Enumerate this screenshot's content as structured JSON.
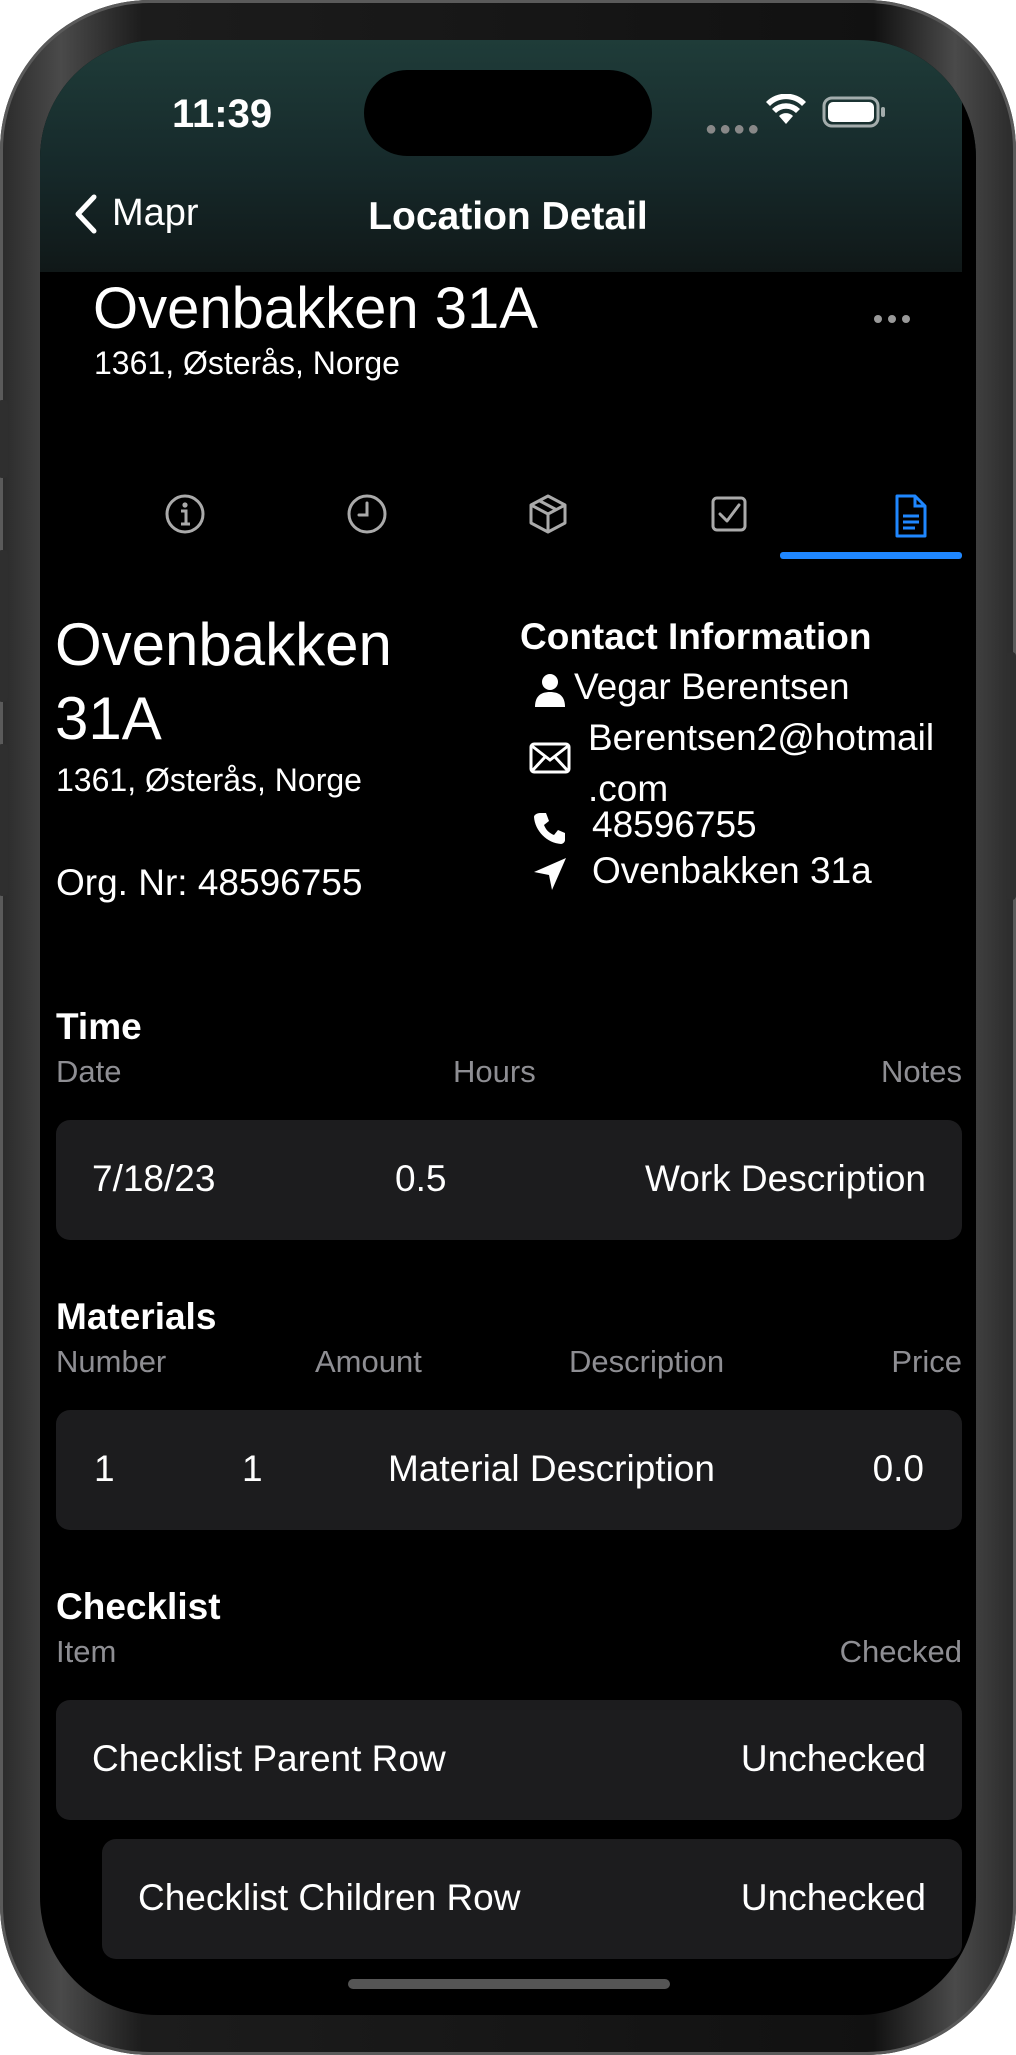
{
  "status_bar": {
    "time": "11:39"
  },
  "nav": {
    "back_label": "Mapr",
    "title": "Location Detail"
  },
  "header": {
    "title": "Ovenbakken 31A",
    "subtitle": "1361, Østerås, Norge"
  },
  "tabs": [
    {
      "name": "info",
      "icon": "info-circle-icon"
    },
    {
      "name": "time",
      "icon": "clock-icon"
    },
    {
      "name": "materials",
      "icon": "box-icon"
    },
    {
      "name": "checklist",
      "icon": "checkbox-icon"
    },
    {
      "name": "document",
      "icon": "document-icon",
      "selected": true
    }
  ],
  "accent_color": "#1F87FF",
  "location": {
    "title": "Ovenbakken 31A",
    "subtitle": "1361, Østerås, Norge",
    "org_nr": "Org. Nr: 48596755"
  },
  "contact": {
    "title": "Contact Information",
    "name": "Vegar Berentsen",
    "email_line1": "Berentsen2@hotmail",
    "email_line2": ".com",
    "phone": "48596755",
    "address": "Ovenbakken 31a"
  },
  "time_section": {
    "title": "Time",
    "headers": {
      "date": "Date",
      "hours": "Hours",
      "notes": "Notes"
    },
    "row": {
      "date": "7/18/23",
      "hours": "0.5",
      "notes": "Work Description"
    }
  },
  "materials_section": {
    "title": "Materials",
    "headers": {
      "number": "Number",
      "amount": "Amount",
      "description": "Description",
      "price": "Price"
    },
    "row": {
      "number": "1",
      "amount": "1",
      "description": "Material Description",
      "price": "0.0"
    }
  },
  "checklist_section": {
    "title": "Checklist",
    "headers": {
      "item": "Item",
      "checked": "Checked"
    },
    "rows": [
      {
        "item": "Checklist Parent Row",
        "checked": "Unchecked"
      },
      {
        "item": "Checklist Children Row",
        "checked": "Unchecked"
      }
    ]
  }
}
